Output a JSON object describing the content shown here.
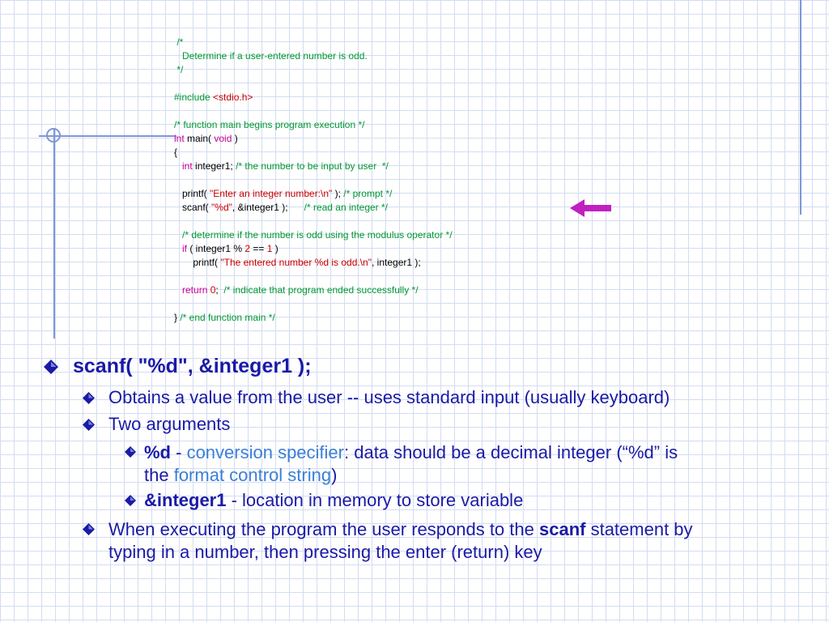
{
  "code_lines": [
    [
      {
        "t": " /*",
        "c": "c"
      }
    ],
    [
      {
        "t": "   Determine if a user-entered number is odd.",
        "c": "c"
      }
    ],
    [
      {
        "t": " */",
        "c": "c"
      }
    ],
    [],
    [
      {
        "t": "#include ",
        "c": "c"
      },
      {
        "t": "<stdio.h>",
        "c": "s"
      }
    ],
    [],
    [
      {
        "t": "/* function main begins program execution */",
        "c": "c"
      }
    ],
    [
      {
        "t": "int",
        "c": "k"
      },
      {
        "t": " main( ",
        "c": ""
      },
      {
        "t": "void",
        "c": "k"
      },
      {
        "t": " )",
        "c": ""
      }
    ],
    [
      {
        "t": "{",
        "c": ""
      }
    ],
    [
      {
        "t": "   ",
        "c": ""
      },
      {
        "t": "int",
        "c": "k"
      },
      {
        "t": " integer1; ",
        "c": ""
      },
      {
        "t": "/* the number to be input by user  */",
        "c": "c"
      }
    ],
    [],
    [
      {
        "t": "   printf( ",
        "c": ""
      },
      {
        "t": "\"Enter an integer number:\\n\"",
        "c": "s"
      },
      {
        "t": " ); ",
        "c": ""
      },
      {
        "t": "/* prompt */",
        "c": "c"
      }
    ],
    [
      {
        "t": "   scanf( ",
        "c": ""
      },
      {
        "t": "\"%d\"",
        "c": "s"
      },
      {
        "t": ", &integer1 );      ",
        "c": ""
      },
      {
        "t": "/* read an integer */",
        "c": "c"
      }
    ],
    [],
    [
      {
        "t": "   /* determine if the number is odd using the modulus operator */",
        "c": "c"
      }
    ],
    [
      {
        "t": "   ",
        "c": ""
      },
      {
        "t": "if",
        "c": "k"
      },
      {
        "t": " ( integer1 % ",
        "c": ""
      },
      {
        "t": "2",
        "c": "n"
      },
      {
        "t": " == ",
        "c": ""
      },
      {
        "t": "1",
        "c": "n"
      },
      {
        "t": " )",
        "c": ""
      }
    ],
    [
      {
        "t": "       printf( ",
        "c": ""
      },
      {
        "t": "\"The entered number %d is odd.\\n\"",
        "c": "s"
      },
      {
        "t": ", integer1 );",
        "c": ""
      }
    ],
    [],
    [
      {
        "t": "   ",
        "c": ""
      },
      {
        "t": "return",
        "c": "k"
      },
      {
        "t": " ",
        "c": ""
      },
      {
        "t": "0",
        "c": "n"
      },
      {
        "t": ";  ",
        "c": ""
      },
      {
        "t": "/* indicate that program ended successfully */",
        "c": "c"
      }
    ],
    [],
    [
      {
        "t": "} ",
        "c": ""
      },
      {
        "t": "/* end function main */",
        "c": "c"
      }
    ]
  ],
  "bullets": {
    "main": "scanf( \"%d\", &integer1 );",
    "obtains": "Obtains a value from the user -- uses standard input (usually keyboard)",
    "two_args": "Two arguments",
    "pct_d_bold": "%d",
    "pct_d_dash": " - ",
    "conv_spec": "conversion specifier",
    "pct_d_rest1": ": data should be a decimal integer (“%d” is",
    "pct_d_rest2_pre": "the ",
    "fmt_ctrl": "format control string",
    "pct_d_rest2_post": ")",
    "integer1_bold": "&integer1",
    "integer1_rest": " - location in memory to store variable",
    "when_pre": "When executing the program the user responds to the ",
    "when_bold": "scanf",
    "when_post": " statement by",
    "when_line2": "typing in a number, then pressing the enter (return) key"
  },
  "colors": {
    "bullet_text": "#1a1aa6",
    "highlight": "#3a7fd6",
    "comment": "#009933",
    "keyword": "#cc0099",
    "string": "#cc0000",
    "arrow": "#c020c0"
  }
}
